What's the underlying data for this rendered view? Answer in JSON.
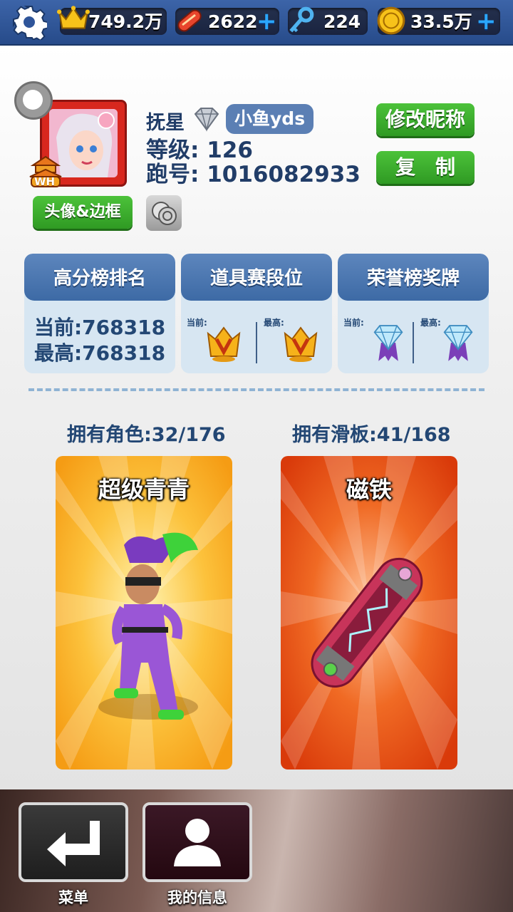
{
  "topbar": {
    "crowns": "749.2万",
    "hoverboards": "2622",
    "keys": "224",
    "coins": "33.5万"
  },
  "profile": {
    "name": "抚星",
    "tag": "小鱼yds",
    "level_text": "等级: 126",
    "runner_id_text": "跑号: 1016082933",
    "avatar_badge": "WH",
    "avatar_frame_button": "头像&边框",
    "rename_button": "修改昵称",
    "copy_button": "复　制"
  },
  "cards": {
    "highscore": {
      "title": "高分榜排名",
      "current": "当前:768318",
      "best": "最高:768318"
    },
    "items_rank": {
      "title": "道具赛段位",
      "current_label": "当前:",
      "best_label": "最高:"
    },
    "honor": {
      "title": "荣誉榜奖牌",
      "current_label": "当前:",
      "best_label": "最高:"
    }
  },
  "owned": {
    "characters": "拥有角色:32/176",
    "boards": "拥有滑板:41/168"
  },
  "showcase": {
    "character_name": "超级青青",
    "board_name": "磁铁"
  },
  "nav": {
    "menu": "菜单",
    "my_info": "我的信息"
  },
  "colors": {
    "topbar": "#2f559a",
    "accent_green": "#3aae2e",
    "card_head": "#4a76b0",
    "card_body": "#d7e6f2",
    "character_bg": "#f9a826",
    "board_bg": "#e5470f"
  }
}
